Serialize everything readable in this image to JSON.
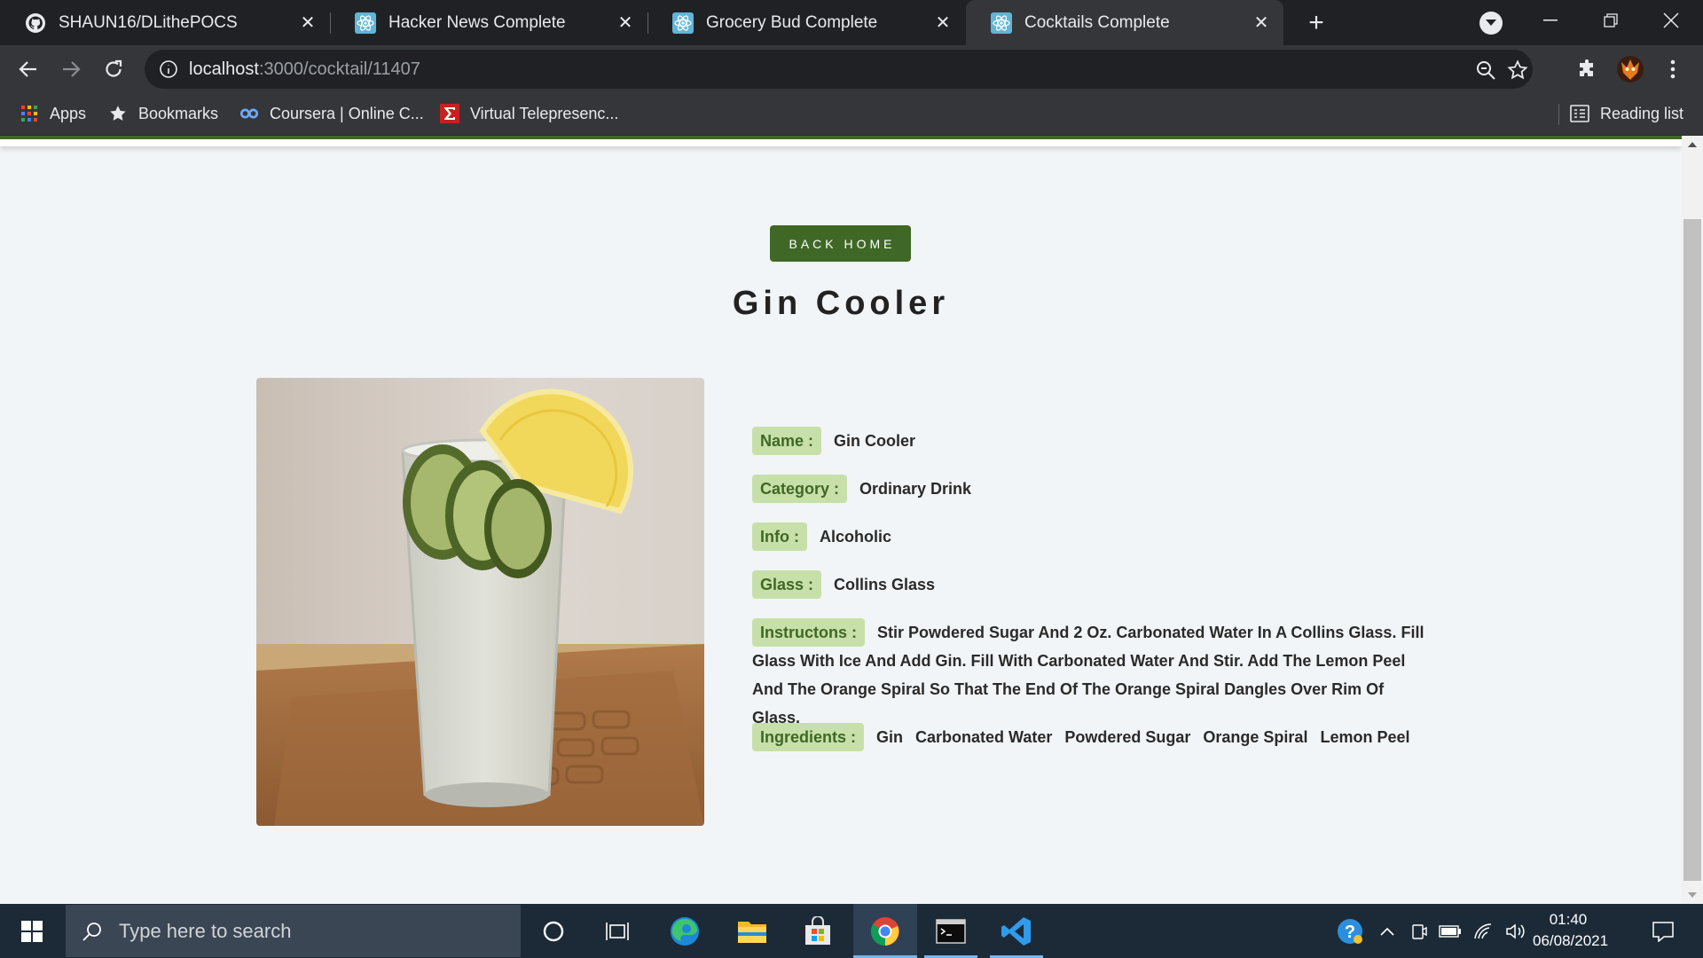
{
  "browser": {
    "tabs": [
      {
        "title": "SHAUN16/DLithePOCS",
        "icon": "github-icon"
      },
      {
        "title": "Hacker News Complete",
        "icon": "react-icon"
      },
      {
        "title": "Grocery Bud Complete",
        "icon": "react-icon"
      },
      {
        "title": "Cocktails Complete",
        "icon": "react-icon",
        "active": true
      }
    ],
    "url_host": "localhost",
    "url_path": ":3000/cocktail/11407",
    "bookmarks": [
      {
        "label": "Apps",
        "icon": "apps-grid-icon"
      },
      {
        "label": "Bookmarks",
        "icon": "star-icon"
      },
      {
        "label": "Coursera | Online C...",
        "icon": "coursera-icon"
      },
      {
        "label": "Virtual Telepresenc...",
        "icon": "sigma-icon"
      }
    ],
    "reading_list": "Reading list"
  },
  "page": {
    "back_button": "Back Home",
    "title": "Gin Cooler",
    "image_alt": "Gin Cooler",
    "details": {
      "name_label": "Name :",
      "name": "Gin Cooler",
      "category_label": "Category :",
      "category": "Ordinary Drink",
      "info_label": "Info :",
      "info": "Alcoholic",
      "glass_label": "Glass :",
      "glass": "Collins Glass",
      "instructions_label": "Instructons :",
      "instructions": "Stir Powdered Sugar And 2 Oz. Carbonated Water In A Collins Glass. Fill Glass With Ice And Add Gin. Fill With Carbonated Water And Stir. Add The Lemon Peel And The Orange Spiral So That The End Of The Orange Spiral Dangles Over Rim Of Glass.",
      "ingredients_label": "Ingredients :",
      "ingredients": [
        "Gin",
        "Carbonated Water",
        "Powdered Sugar",
        "Orange Spiral",
        "Lemon Peel"
      ]
    },
    "colors": {
      "primary": "#3f6826",
      "label_bg": "#c7e0a9",
      "background": "#f1f5f8"
    }
  },
  "taskbar": {
    "search_placeholder": "Type here to search",
    "time": "01:40",
    "date": "06/08/2021"
  }
}
